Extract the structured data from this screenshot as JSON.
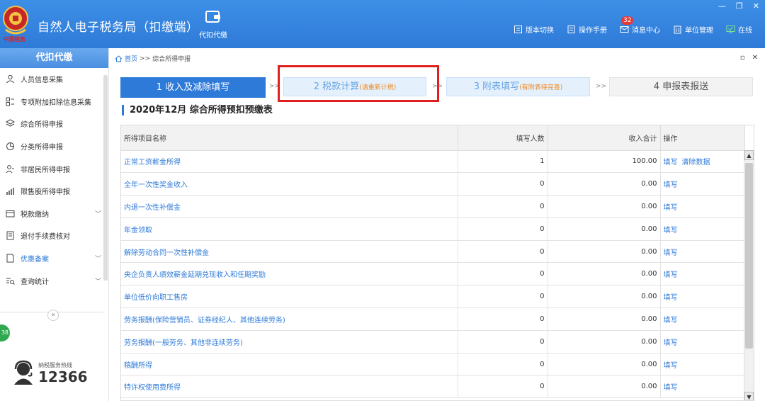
{
  "header": {
    "emblem_text": "中国税务",
    "app_title": "自然人电子税务局（扣缴端）",
    "main_nav_label": "代扣代缴",
    "tools": [
      {
        "label": "版本切换",
        "icon": "version-icon"
      },
      {
        "label": "操作手册",
        "icon": "manual-icon"
      },
      {
        "label": "消息中心",
        "icon": "message-icon",
        "badge": "32"
      },
      {
        "label": "单位管理",
        "icon": "building-icon"
      },
      {
        "label": "在线",
        "icon": "online-icon"
      }
    ],
    "colors": {
      "bar": "#2e7ad8",
      "badge": "#e53935"
    }
  },
  "sidebar": {
    "title": "代扣代缴",
    "items": [
      {
        "label": "人员信息采集",
        "icon": "person-icon"
      },
      {
        "label": "专项附加扣除信息采集",
        "icon": "grid-icon"
      },
      {
        "label": "综合所得申报",
        "icon": "layers-icon"
      },
      {
        "label": "分类所得申报",
        "icon": "pie-icon"
      },
      {
        "label": "非居民所得申报",
        "icon": "user-icon"
      },
      {
        "label": "限售股所得申报",
        "icon": "bar-icon"
      },
      {
        "label": "税款缴纳",
        "icon": "wallet-icon",
        "chevron": "﹀"
      },
      {
        "label": "退付手续费核对",
        "icon": "receipt-icon"
      },
      {
        "label": "优惠备案",
        "icon": "doc-icon",
        "chevron": "﹀"
      },
      {
        "label": "查询统计",
        "icon": "query-icon",
        "chevron": "﹀"
      }
    ],
    "collapse_symbol": "«",
    "green_badge": "38",
    "hotline_label": "纳税服务热线",
    "hotline_number": "12366"
  },
  "breadcrumb": {
    "home": "首页",
    "separator": ">>",
    "current": "综合所得申报"
  },
  "steps": [
    {
      "label": "1 收入及减除填写",
      "sub": ""
    },
    {
      "label": "2 税款计算",
      "sub": "(请重新计税)"
    },
    {
      "label": "3 附表填写",
      "sub": "(有附表待完善)"
    },
    {
      "label": "4 申报表报送",
      "sub": ""
    }
  ],
  "step_separator": ">>",
  "table_title": "2020年12月  综合所得预扣预缴表",
  "table": {
    "headers": [
      "所得项目名称",
      "填写人数",
      "收入合计",
      "操作"
    ],
    "rows": [
      {
        "name": "正常工资薪金所得",
        "count": "1",
        "sum": "100.00",
        "ops": [
          "填写",
          "清除数据"
        ]
      },
      {
        "name": "全年一次性奖金收入",
        "count": "0",
        "sum": "0.00",
        "ops": [
          "填写"
        ]
      },
      {
        "name": "内退一次性补偿金",
        "count": "0",
        "sum": "0.00",
        "ops": [
          "填写"
        ]
      },
      {
        "name": "年金领取",
        "count": "0",
        "sum": "0.00",
        "ops": [
          "填写"
        ]
      },
      {
        "name": "解除劳动合同一次性补偿金",
        "count": "0",
        "sum": "0.00",
        "ops": [
          "填写"
        ]
      },
      {
        "name": "央企负责人绩效薪金延期兑现收入和任期奖励",
        "count": "0",
        "sum": "0.00",
        "ops": [
          "填写"
        ]
      },
      {
        "name": "单位低价向职工售房",
        "count": "0",
        "sum": "0.00",
        "ops": [
          "填写"
        ]
      },
      {
        "name": "劳务报酬(保险营销员、证券经纪人、其他连续劳务)",
        "count": "0",
        "sum": "0.00",
        "ops": [
          "填写"
        ]
      },
      {
        "name": "劳务报酬(一般劳务、其他非连续劳务)",
        "count": "0",
        "sum": "0.00",
        "ops": [
          "填写"
        ]
      },
      {
        "name": "稿酬所得",
        "count": "0",
        "sum": "0.00",
        "ops": [
          "填写"
        ]
      },
      {
        "name": "特许权使用费所得",
        "count": "0",
        "sum": "0.00",
        "ops": [
          "填写"
        ]
      }
    ]
  }
}
